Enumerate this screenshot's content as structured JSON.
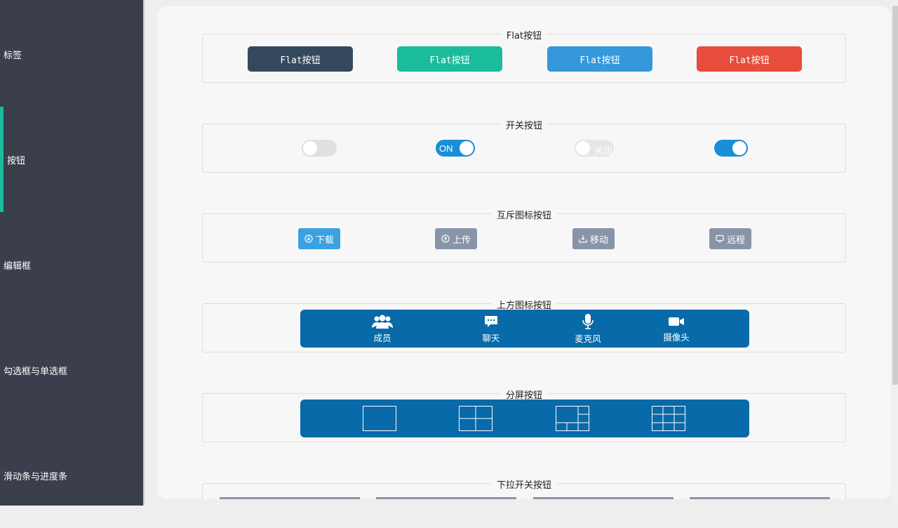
{
  "sidebar": {
    "items": [
      {
        "label": "标签"
      },
      {
        "label": "按钮"
      },
      {
        "label": "编辑框"
      },
      {
        "label": "勾选框与单选框"
      },
      {
        "label": "滑动条与进度条"
      }
    ]
  },
  "groups": {
    "flat": {
      "title": "Flat按钮",
      "buttons": [
        {
          "label": "Flat按钮",
          "color": "#34495e"
        },
        {
          "label": "Flat按钮",
          "color": "#1abc9c"
        },
        {
          "label": "Flat按钮",
          "color": "#3498db"
        },
        {
          "label": "Flat按钮",
          "color": "#e74c3c"
        }
      ]
    },
    "switch": {
      "title": "开关按钮",
      "items": [
        {
          "state": "off",
          "text": ""
        },
        {
          "state": "on",
          "text": "ON"
        },
        {
          "state": "off",
          "text": "关闭"
        },
        {
          "state": "on",
          "text": ""
        }
      ]
    },
    "mutex": {
      "title": "互斥图标按钮",
      "buttons": [
        {
          "label": "下载",
          "icon": "download-icon",
          "active": true
        },
        {
          "label": "上传",
          "icon": "upload-icon",
          "active": false
        },
        {
          "label": "移动",
          "icon": "move-icon",
          "active": false
        },
        {
          "label": "远程",
          "icon": "monitor-icon",
          "active": false
        }
      ],
      "active_color": "#3ba1e0",
      "inactive_color": "#8895a8"
    },
    "topicon": {
      "title": "上方图标按钮",
      "buttons": [
        {
          "label": "成员",
          "icon": "members-icon"
        },
        {
          "label": "聊天",
          "icon": "chat-icon"
        },
        {
          "label": "麦克风",
          "icon": "microphone-icon"
        },
        {
          "label": "摄像头",
          "icon": "camera-icon"
        }
      ]
    },
    "split": {
      "title": "分屏按钮",
      "buttons": [
        {
          "icon": "split-1-icon"
        },
        {
          "icon": "split-4-icon"
        },
        {
          "icon": "split-6-icon"
        },
        {
          "icon": "split-9-icon"
        }
      ]
    },
    "dropdown": {
      "title": "下拉开关按钮"
    }
  }
}
